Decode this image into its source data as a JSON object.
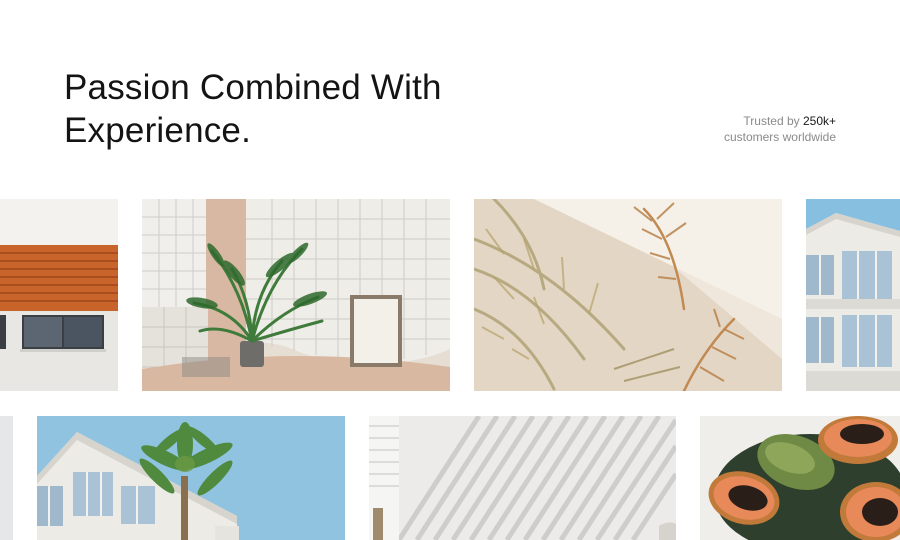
{
  "hero": {
    "title_line1": "Passion Combined With",
    "title_line2": "Experience."
  },
  "trust": {
    "prefix": "Trusted by ",
    "count": "250k+",
    "suffix": "customers worldwide"
  },
  "gallery": {
    "row1": [
      {
        "name": "orange-awning-building-photo"
      },
      {
        "name": "tiled-room-palm-plant-photo"
      },
      {
        "name": "palm-leaf-shadows-photo"
      },
      {
        "name": "white-building-blue-sky-photo"
      }
    ],
    "row2": [
      {
        "name": "partial-edge-photo"
      },
      {
        "name": "palm-tree-building-photo"
      },
      {
        "name": "striped-light-shadows-photo"
      },
      {
        "name": "papaya-bowl-photo"
      }
    ]
  },
  "colors": {
    "background": "#ffffff",
    "text": "#141414",
    "muted": "#8a8a8a",
    "awning": "#c8642a",
    "sky": "#8fc3e0",
    "beige": "#e9dccb",
    "plant": "#3f7b3a",
    "papaya": "#e8895a"
  }
}
